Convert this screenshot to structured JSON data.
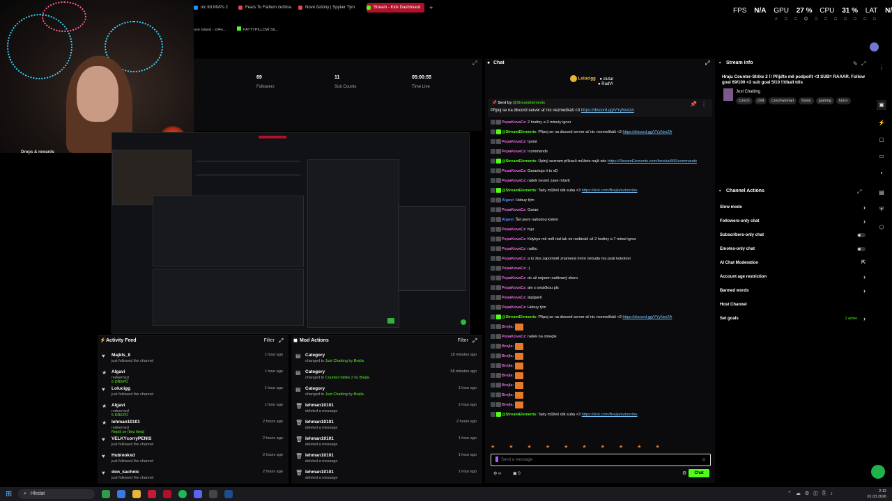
{
  "browser_tabs": [
    {
      "label": "nic Kit MVPs 2",
      "color": "#1e90ff"
    },
    {
      "label": "Fears To Fathom čeština",
      "color": "#e0465a"
    },
    {
      "label": "Nové češtiny | Spyker Tým",
      "color": "#e0465a"
    },
    {
      "label": "Stream - Kick Dashboard",
      "color": "#53fc18",
      "active": true
    }
  ],
  "new_tab": "+",
  "bookmarks": [
    "ove Island - s04e...",
    "FATTYPILLOW Str..."
  ],
  "perf": {
    "fps_label": "FPS",
    "fps": "N/A",
    "gpu_label": "GPU",
    "gpu": "27 %",
    "cpu_label": "CPU",
    "cpu": "31 %",
    "lat_label": "LAT",
    "lat": "N/A"
  },
  "stats": [
    {
      "value": "69",
      "label": "Followers"
    },
    {
      "value": "11",
      "label": "Sub Counts"
    },
    {
      "value": "05:00:55",
      "label": "Time Live"
    }
  ],
  "drops_label": "Drops & rewards",
  "activity_feed": {
    "title": "Activity Feed",
    "filter": "Filter",
    "items": [
      {
        "name": "Majkls_8",
        "desc": "just followed the channel",
        "reward": "",
        "time": "1 hour ago",
        "icon": "heart-icon"
      },
      {
        "name": "Algavi",
        "desc": "redeemed",
        "reward": "5 DŘEPŮ",
        "time": "1 hour ago",
        "icon": "star-icon"
      },
      {
        "name": "Lolucigg",
        "desc": "just followed the channel",
        "reward": "",
        "time": "1 hour ago",
        "icon": "heart-icon"
      },
      {
        "name": "Algavi",
        "desc": "redeemed",
        "reward": "5 DŘEPŮ",
        "time": "1 hour ago",
        "icon": "star-icon"
      },
      {
        "name": "lehman10101",
        "desc": "redeemed",
        "reward": "Nepiš se (bez tima)",
        "time": "2 hours ago",
        "icon": "star-icon"
      },
      {
        "name": "VELKYcorryPENIS",
        "desc": "just followed the channel",
        "reward": "",
        "time": "2 hours ago",
        "icon": "heart-icon"
      },
      {
        "name": "Hubinokxd",
        "desc": "just followed the channel",
        "reward": "",
        "time": "2 hours ago",
        "icon": "heart-icon"
      },
      {
        "name": "don_kachnic",
        "desc": "just followed the channel",
        "reward": "",
        "time": "2 hours ago",
        "icon": "heart-icon"
      }
    ]
  },
  "mod_actions": {
    "title": "Mod Actions",
    "filter": "Filter",
    "items": [
      {
        "name": "Category",
        "desc": "changed to",
        "value": "Just Chatting",
        "by": "by",
        "actor": "Brejla",
        "time": "18 minutes ago",
        "icon": "category-icon"
      },
      {
        "name": "Category",
        "desc": "changed to",
        "value": "Counter-Strike 2",
        "by": "by",
        "actor": "Brejla",
        "time": "58 minutes ago",
        "icon": "category-icon"
      },
      {
        "name": "Category",
        "desc": "changed to",
        "value": "Just Chatting",
        "by": "by",
        "actor": "Brejla",
        "time": "1 hour ago",
        "icon": "category-icon"
      },
      {
        "name": "lehman10101",
        "desc": "deleted a message",
        "value": "",
        "by": "",
        "actor": "",
        "time": "1 hour ago",
        "icon": "trash-icon"
      },
      {
        "name": "lehman10101",
        "desc": "deleted a message",
        "value": "",
        "by": "",
        "actor": "",
        "time": "2 hours ago",
        "icon": "trash-icon"
      },
      {
        "name": "lehman10101",
        "desc": "deleted a message",
        "value": "",
        "by": "",
        "actor": "",
        "time": "1 hour ago",
        "icon": "trash-icon"
      },
      {
        "name": "lehman10101",
        "desc": "deleted a message",
        "value": "",
        "by": "",
        "actor": "",
        "time": "1 hour ago",
        "icon": "trash-icon"
      },
      {
        "name": "lehman10101",
        "desc": "deleted a message",
        "value": "",
        "by": "",
        "actor": "",
        "time": "1 hour ago",
        "icon": "trash-icon"
      }
    ]
  },
  "chat": {
    "title": "Chat",
    "goal_user": "Lolucigg",
    "goal_items": [
      "slutar",
      "RadVi"
    ],
    "pinned_by_label": "Sent by",
    "pinned_by": "@StreamElements",
    "pinned_text": "Připoj se na discord server ať nic nezmeškáš <3",
    "pinned_link": "https://discord.gg/VYyNxx2A",
    "messages": [
      {
        "user": "PepaKovaCz",
        "color": "#e26ad8",
        "text": "2 hodiny a 3 minuty ignor",
        "link": ""
      },
      {
        "user": "@StreamElements",
        "color": "#53fc18",
        "text": "Připoj se na discord server ať nic nezmeškáš <3",
        "link": "https://discord.gg/VYyNxx2A"
      },
      {
        "user": "PepaKovaCz",
        "color": "#e26ad8",
        "text": "!point",
        "link": ""
      },
      {
        "user": "PepaKovaCz",
        "color": "#e26ad8",
        "text": "!commands",
        "link": ""
      },
      {
        "user": "@StreamElements",
        "color": "#53fc18",
        "text": "Úplný seznam příkazů můžete najít zde",
        "link": "https://StreamElements.com/brcokai666/commands"
      },
      {
        "user": "PepaKovaCz",
        "color": "#e26ad8",
        "text": "Garantuju ti to xD",
        "link": ""
      },
      {
        "user": "PepaKovaCz",
        "color": "#e26ad8",
        "text": "radek neumí zase mluvit",
        "link": ""
      },
      {
        "user": "@StreamElements",
        "color": "#53fc18",
        "text": "Tady můžeš dát suba <3",
        "link": "https://kick.com/Brejla/subscribe"
      },
      {
        "user": "Algavi",
        "color": "#4f8cff",
        "text": "Hebuy tým",
        "link": ""
      },
      {
        "user": "PepaKovaCz",
        "color": "#e26ad8",
        "text": "Garan",
        "link": ""
      },
      {
        "user": "Algavi",
        "color": "#4f8cff",
        "text": "Šel jsem nahodou kolem",
        "link": ""
      },
      {
        "user": "PepaKovaCz",
        "color": "#e26ad8",
        "text": "fuju",
        "link": ""
      },
      {
        "user": "PepaKovaCz",
        "color": "#e26ad8",
        "text": "Kdybys mě měl rád tak mi nedáváš už 2 hodiny a 7 minut ignor",
        "link": ""
      },
      {
        "user": "PepaKovaCz",
        "color": "#e26ad8",
        "text": "radku",
        "link": ""
      },
      {
        "user": "PepaKovaCz",
        "color": "#e26ad8",
        "text": "a to žes zapomněl znamená hmm nebudu mu psát kokotovi",
        "link": ""
      },
      {
        "user": "PepaKovaCz",
        "color": "#e26ad8",
        "text": ":(",
        "link": ""
      },
      {
        "user": "PepaKovaCz",
        "color": "#e26ad8",
        "text": "ok už nejsem naštvaný skoro",
        "link": ""
      },
      {
        "user": "PepaKovaCz",
        "color": "#e26ad8",
        "text": "ale s omáčkou pls",
        "link": ""
      },
      {
        "user": "PepaKovaCz",
        "color": "#e26ad8",
        "text": "algigavil",
        "link": ""
      },
      {
        "user": "PepaKovaCz",
        "color": "#e26ad8",
        "text": "Hebuy tým",
        "link": ""
      },
      {
        "user": "@StreamElements",
        "color": "#53fc18",
        "text": "Připoj se na discord server ať nic nezmeškáš <3",
        "link": "https://discord.gg/VYyNxx2A"
      },
      {
        "user": "Brejla",
        "color": "#e26ad8",
        "text": "",
        "link": ""
      },
      {
        "user": "PepaKovaCz",
        "color": "#e26ad8",
        "text": "radek na omegle",
        "link": ""
      },
      {
        "user": "Brejla",
        "color": "#e26ad8",
        "text": "",
        "link": ""
      },
      {
        "user": "Brejla",
        "color": "#e26ad8",
        "text": "",
        "link": ""
      },
      {
        "user": "Brejla",
        "color": "#e26ad8",
        "text": "",
        "link": ""
      },
      {
        "user": "Brejla",
        "color": "#e26ad8",
        "text": "",
        "link": ""
      },
      {
        "user": "Brejla",
        "color": "#e26ad8",
        "text": "",
        "link": ""
      },
      {
        "user": "Brejla",
        "color": "#e26ad8",
        "text": "",
        "link": ""
      },
      {
        "user": "Brejla",
        "color": "#e26ad8",
        "text": "",
        "link": ""
      },
      {
        "user": "@StreamElements",
        "color": "#53fc18",
        "text": "Tady můžeš dát suba <3",
        "link": "https://kick.com/Brejla/subscribe"
      }
    ],
    "input_placeholder": "Send a message",
    "viewer_count": "0",
    "send_label": "Chat"
  },
  "stream_info": {
    "title": "Stream info",
    "stream_title": "Hraju Counter-Strike 2 !! Přijďte mě podpořit <3 SUB= RAAAR. Follow goal 69/100 <3 sub goal 5/10 !!tíball tdis",
    "category": "Just Chatting",
    "tags": [
      "Czech",
      "chill",
      "czechwoman",
      "funny",
      "gaming",
      "horor"
    ]
  },
  "channel_actions": {
    "title": "Channel Actions",
    "items": [
      {
        "label": "Slow mode",
        "control": "chevron",
        "extra": ""
      },
      {
        "label": "Followers-only chat",
        "control": "chevron",
        "extra": ""
      },
      {
        "label": "Subscribers-only chat",
        "control": "toggle",
        "extra": ""
      },
      {
        "label": "Emotes-only chat",
        "control": "toggle",
        "extra": ""
      },
      {
        "label": "AI Chat Moderation",
        "control": "external",
        "extra": ""
      },
      {
        "label": "Account age restriction",
        "control": "chevron",
        "extra": ""
      },
      {
        "label": "Banned words",
        "control": "chevron",
        "extra": ""
      },
      {
        "label": "Host Channel",
        "control": "none",
        "extra": ""
      },
      {
        "label": "Set goals",
        "control": "chevron",
        "extra": "2 active"
      }
    ]
  },
  "taskbar": {
    "search_label": "Hledat",
    "time": "2:12",
    "date": "01.03.2026"
  },
  "colors": {
    "kick_green": "#53fc18",
    "panel_bg": "#0e0e10",
    "chat_bg": "#0b0b0d",
    "accent_red": "#b0112a"
  }
}
